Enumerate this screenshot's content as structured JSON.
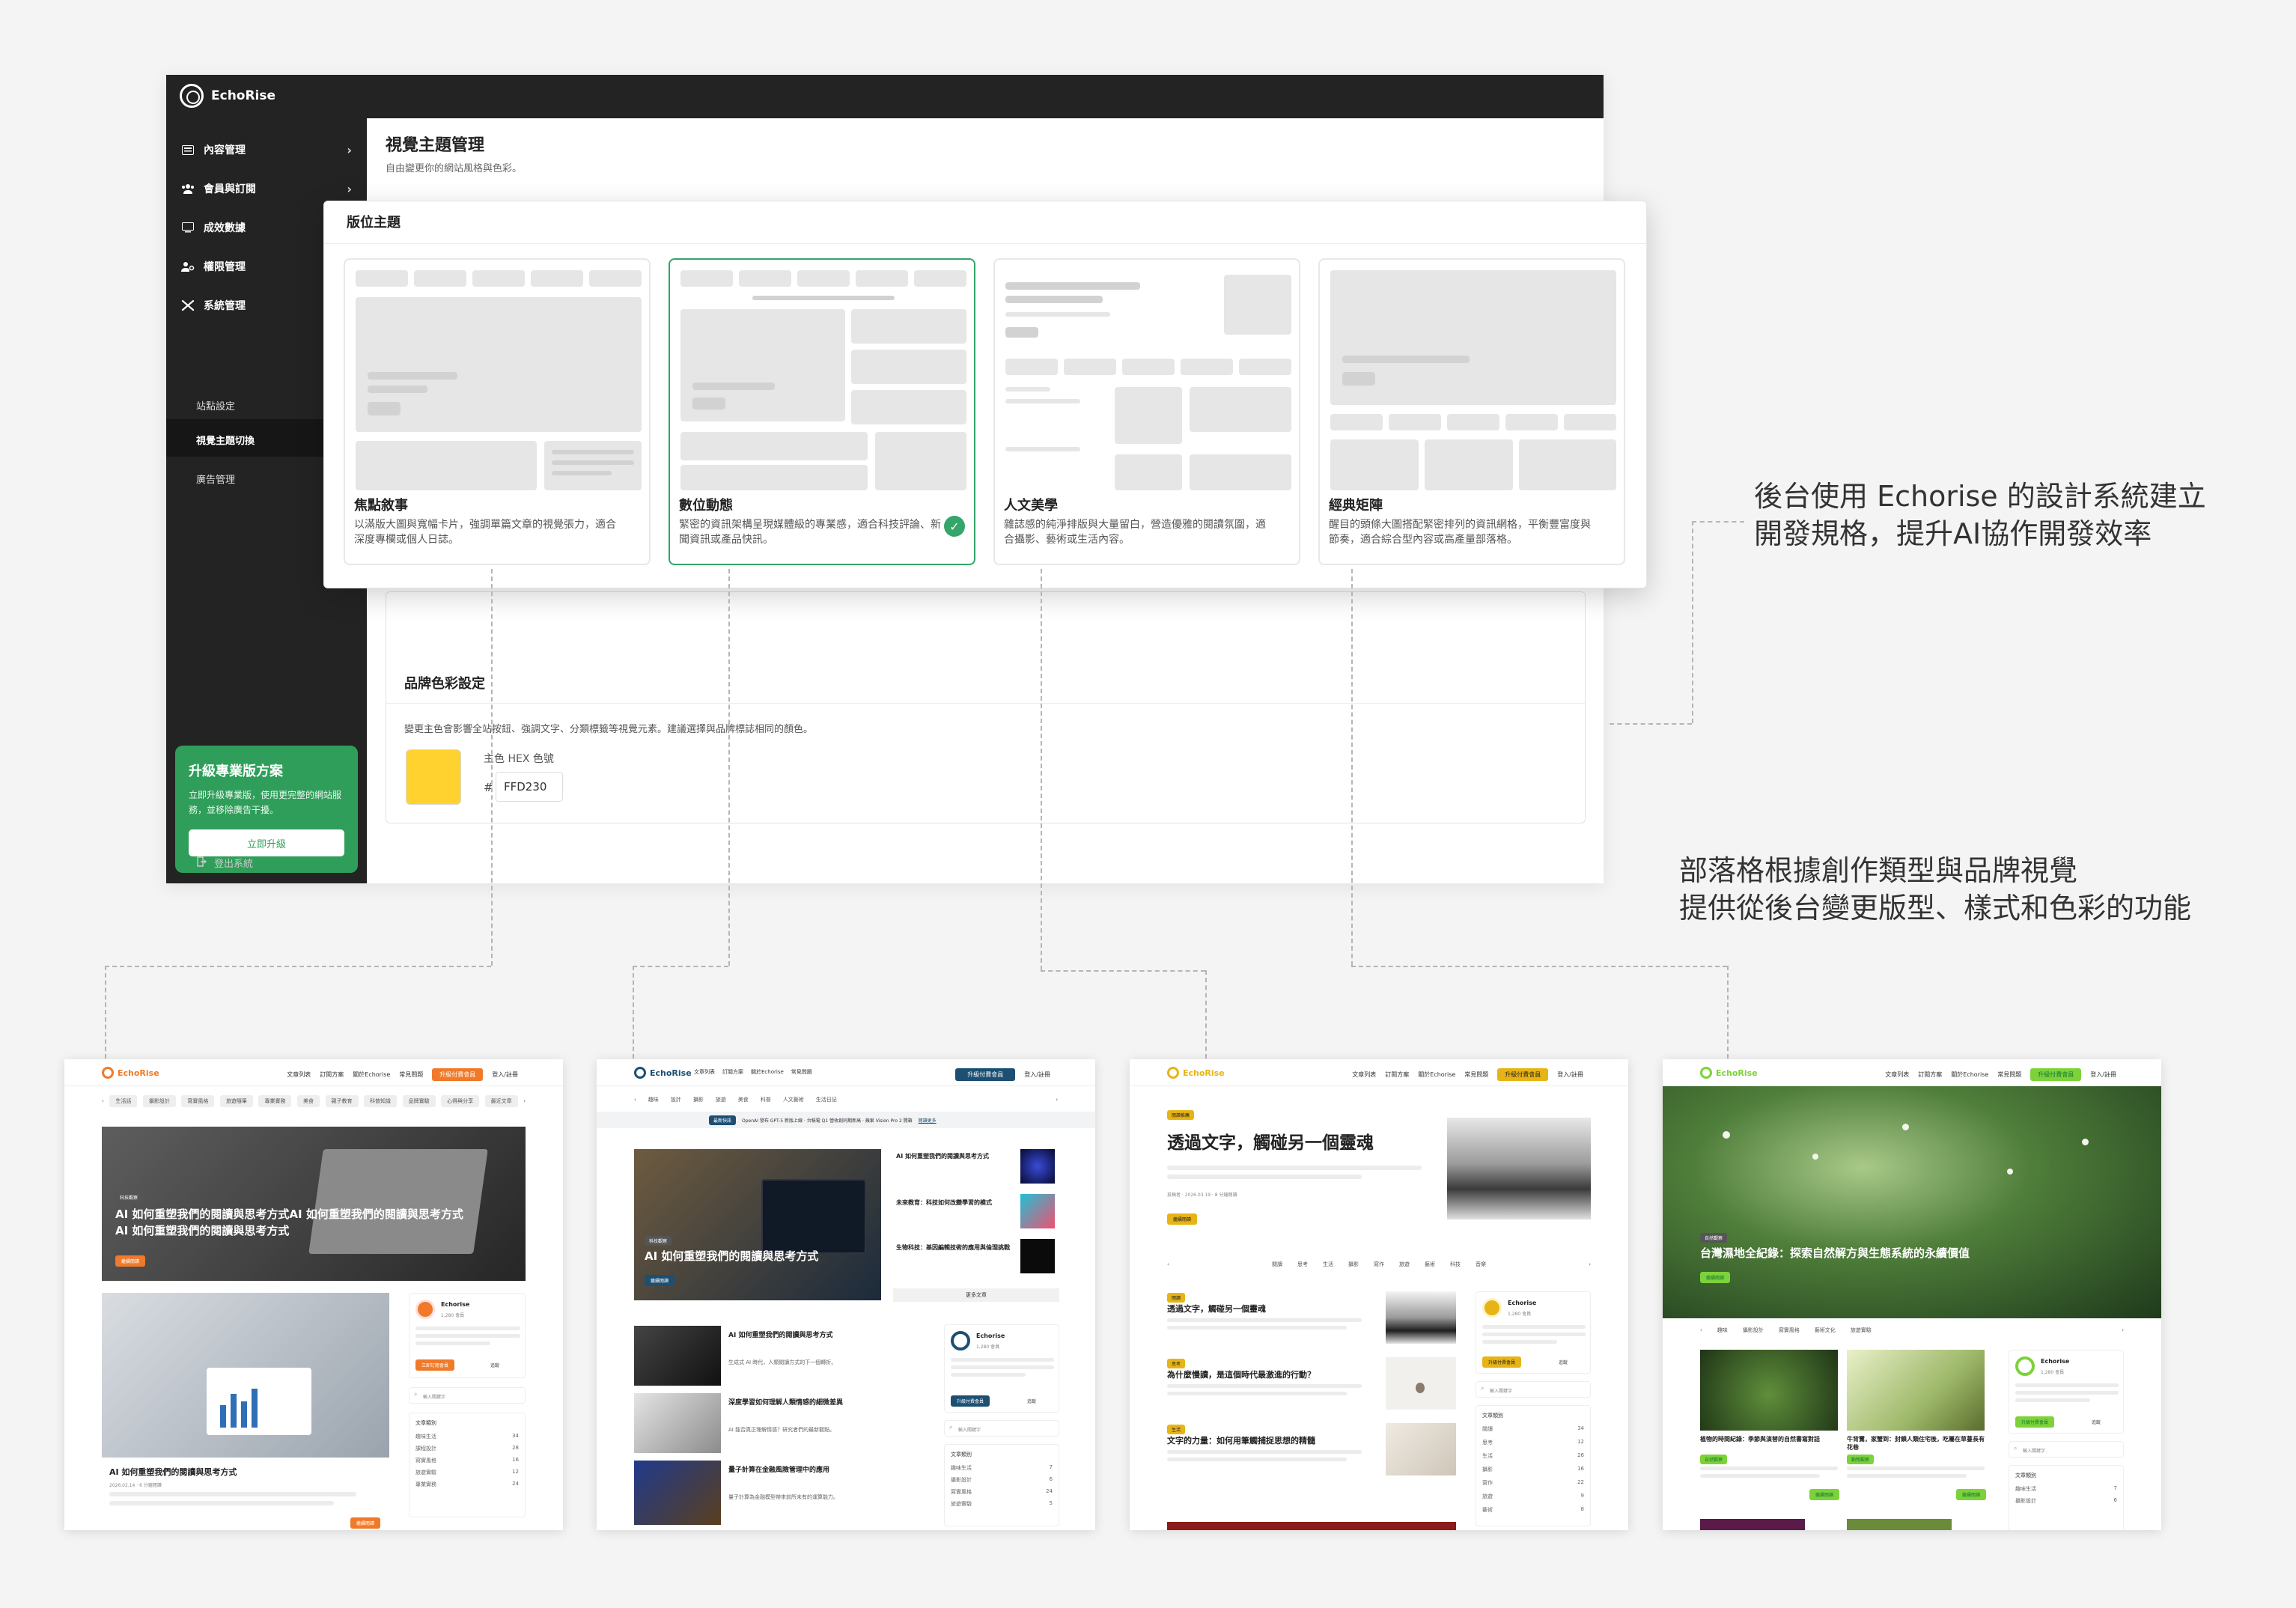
{
  "admin": {
    "brand": "EchoRise",
    "nav": [
      {
        "label": "內容管理",
        "icon": "newspaper-icon"
      },
      {
        "label": "會員與訂閱",
        "icon": "users-icon"
      },
      {
        "label": "成效數據",
        "icon": "monitor-icon"
      },
      {
        "label": "權限管理",
        "icon": "user-key-icon"
      },
      {
        "label": "系統管理",
        "icon": "tools-icon"
      }
    ],
    "sub_nav": [
      "站點設定",
      "視覺主題切換",
      "廣告管理"
    ],
    "page_title": "視覺主題管理",
    "page_sub": "自由變更你的網站風格與色彩。",
    "upgrade": {
      "title": "升級專業版方案",
      "desc": "立即升級專業版，使用更完整的網站服務，並移除廣告干擾。",
      "button": "立即升級"
    },
    "logout": "登出系統"
  },
  "theme_panel": {
    "title": "版位主題",
    "themes": [
      {
        "name": "焦點敘事",
        "desc": "以滿版大圖與寬幅卡片，強調單篇文章的視覺張力，適合深度專欄或個人日誌。"
      },
      {
        "name": "數位動態",
        "desc": "緊密的資訊架構呈現媒體級的專業感，適合科技評論、新聞資訊或產品快訊。"
      },
      {
        "name": "人文美學",
        "desc": "雜誌感的純淨排版與大量留白，營造優雅的閱讀氛圍，適合攝影、藝術或生活內容。"
      },
      {
        "name": "經典矩陣",
        "desc": "醒目的頭條大圖搭配緊密排列的資訊網格，平衡豐富度與節奏，適合綜合型內容或高產量部落格。"
      }
    ]
  },
  "brand_color": {
    "title": "品牌色彩設定",
    "desc": "變更主色會影響全站按鈕、強調文字、分類標籤等視覺元素。建議選擇與品牌標誌相同的顏色。",
    "hex_label": "主色 HEX 色號",
    "hash": "#",
    "hex_value": "FFD230",
    "swatch_color": "#FFD230"
  },
  "callouts": {
    "first": "後台使用 Echorise 的設計系統建立\n開發規格，提升AI協作開發效率",
    "second": "部落格根據創作類型與品牌視覺\n提供從後台變更版型、樣式和色彩的功能"
  },
  "blogs": [
    {
      "accent": "#f07a2a",
      "logo": "EchoRise",
      "nav": [
        "文章列表",
        "訂閱方案",
        "關於Echorise",
        "常見問題"
      ],
      "cta": "升級付費會員",
      "login": "登入/註冊",
      "cats": [
        "生活話",
        "攝影設計",
        "寫實風格",
        "旅遊隨筆",
        "專業實務",
        "美食",
        "親子教育",
        "科普知識",
        "品牌實驗",
        "心得與分享",
        "最近文章"
      ],
      "hero_title": "AI 如何重塑我們的閱讀與思考方式AI 如何重塑我們的閱讀與思考方式\nAI 如何重塑我們的閱讀與思考方式",
      "hero_tag": "科技觀察",
      "hero_btn": "繼續閱讀",
      "card_title": "AI 如何重塑我們的閱讀與思考方式",
      "card_meta": "2026.02.14 · 6 分鐘閱讀",
      "card_btn": "繼續閱讀",
      "side_name": "Echorise",
      "side_sub": "1,280 會員",
      "side_btn": "立即訂閱會員",
      "side_follow": "追蹤",
      "side_search": "輸入關鍵字",
      "side_cat_head": "文章類別",
      "side_cats": [
        [
          "趣味生活",
          "34"
        ],
        [
          "課程設計",
          "28"
        ],
        [
          "寫實風格",
          "16"
        ],
        [
          "旅遊實驗",
          "12"
        ],
        [
          "專業實務",
          "24"
        ]
      ]
    },
    {
      "accent": "#1d4f73",
      "logo": "EchoRise",
      "nav": [
        "文章列表",
        "訂閱方案",
        "關於Echorise",
        "常見問題"
      ],
      "cta": "升級付費會員",
      "login": "登入/註冊",
      "cats": [
        "趣味",
        "設計",
        "攝影",
        "旅遊",
        "美食",
        "科普",
        "人文藝術",
        "生活日記"
      ],
      "ticker_tag": "最新快訊",
      "ticker": "OpenAI 發布 GPT-5 新版上線 · 台積電 Q1 營收創同期新高 · 蘋果 Vision Pro 2 開箱",
      "ticker_more": "閱讀更多",
      "hero_tag": "科技觀察",
      "hero_title": "AI 如何重塑我們的閱讀與思考方式",
      "hero_btn": "繼續閱讀",
      "side_items": [
        "AI 如何重塑我們的閱讀與思考方式",
        "未來教育：科技如何改變學習的模式",
        "生物科技：基因編輯技術的應用與倫理挑戰"
      ],
      "more": "更多文章",
      "list_items": [
        {
          "title": "AI 如何重塑我們的閱讀與思考方式",
          "desc": "生成式 AI 時代，人類閱讀方式的下一個轉折。"
        },
        {
          "title": "深度學習如何理解人類情感的細微差異",
          "desc": "AI 能否真正理解情感？研究者們的最新觀點。"
        },
        {
          "title": "量子計算在金融風險管理中的應用",
          "desc": "量子計算為金融模型帶來前所未有的運算能力。"
        }
      ],
      "side_name": "Echorise",
      "side_sub": "1,280 會員",
      "side_btn": "升級付費會員",
      "side_follow": "追蹤",
      "side_search": "輸入關鍵字",
      "side_cat_head": "文章類別",
      "side_cats": [
        [
          "趣味生活",
          "7"
        ],
        [
          "攝影設計",
          "6"
        ],
        [
          "寫實風格",
          "24"
        ],
        [
          "旅遊實驗",
          "5"
        ]
      ]
    },
    {
      "accent": "#e7b416",
      "logo": "EchoRise",
      "nav": [
        "文章列表",
        "訂閱方案",
        "關於Echorise",
        "常見問題"
      ],
      "cta": "升級付費會員",
      "login": "登入/註冊",
      "hero_tag": "閱讀推薦",
      "big_title": "透過文字，觸碰另一個靈魂",
      "hero_meta": "投稿者 · 2026.03.19 · 8 分鐘閱讀",
      "hero_btn": "繼續閱讀",
      "cats": [
        "閱讀",
        "思考",
        "生活",
        "攝影",
        "寫作",
        "旅遊",
        "藝術",
        "科技",
        "音樂"
      ],
      "list_items": [
        {
          "tag": "閱讀",
          "title": "透過文字，觸碰另一個靈魂"
        },
        {
          "tag": "思考",
          "title": "為什麼慢讀，是這個時代最激進的行動？"
        },
        {
          "tag": "生活",
          "title": "文字的力量：如何用筆觸捕捉思想的精髓"
        }
      ],
      "side_name": "Echorise",
      "side_sub": "1,280 會員",
      "side_btn": "升級付費會員",
      "side_follow": "追蹤",
      "side_search": "輸入關鍵字",
      "side_cat_head": "文章類別",
      "side_cats": [
        [
          "閱讀",
          "34"
        ],
        [
          "思考",
          "12"
        ],
        [
          "生活",
          "26"
        ],
        [
          "攝影",
          "16"
        ],
        [
          "寫作",
          "22"
        ],
        [
          "旅遊",
          "9"
        ],
        [
          "藝術",
          "8"
        ]
      ]
    },
    {
      "accent": "#7dd23a",
      "logo": "EchoRise",
      "nav": [
        "文章列表",
        "訂閱方案",
        "關於Echorise",
        "常見問題"
      ],
      "cta": "升級付費會員",
      "login": "登入/註冊",
      "hero_tag": "自然觀察",
      "hero_title": "台灣濕地全紀錄：探索自然解方與生態系統的永續價值",
      "hero_btn": "繼續閱讀",
      "cats": [
        "趣味",
        "攝影設計",
        "寫實風格",
        "藝術文化",
        "旅遊實驗"
      ],
      "cards": [
        {
          "title": "植物的時間紀錄：季節與演替的自然書寫對話",
          "tag": "自然觀察",
          "btn": "繼續閱讀"
        },
        {
          "title": "牛背鷺，家蟹到：封鎖人類住宅後，吃屬在草蔓長有花巷",
          "tag": "動物觀察",
          "btn": "繼續閱讀"
        }
      ],
      "side_name": "Echorise",
      "side_sub": "1,280 會員",
      "side_btn": "升級付費會員",
      "side_follow": "追蹤",
      "side_search": "輸入關鍵字",
      "side_cat_head": "文章類別",
      "side_cats": [
        [
          "趣味生活",
          "7"
        ],
        [
          "攝影設計",
          "6"
        ]
      ]
    }
  ]
}
